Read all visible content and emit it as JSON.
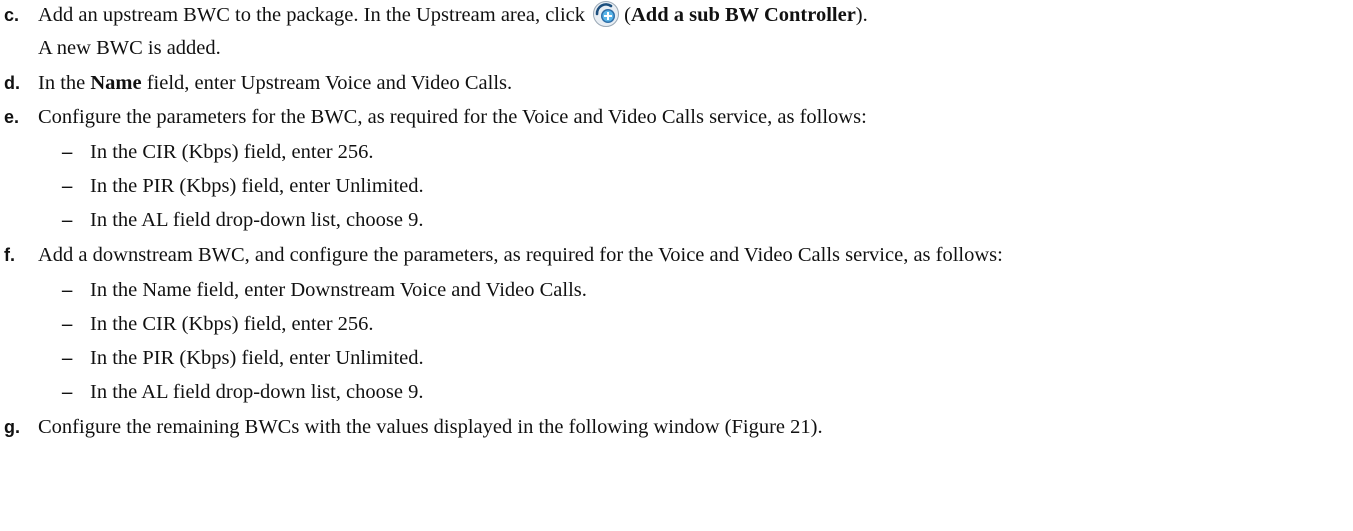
{
  "steps": [
    {
      "marker": "c.",
      "pre": "Add an upstream BWC to the package. In the Upstream area, click",
      "icon": "add-sub-bw-controller-icon",
      "paren_open": "(",
      "bold": "Add a sub BW Controller",
      "post": ").",
      "continuation": "A new BWC is added."
    },
    {
      "marker": "d.",
      "pre": "In the",
      "bold": "Name",
      "post": "field, enter Upstream Voice and Video Calls."
    },
    {
      "marker": "e.",
      "text": "Configure the parameters for the BWC, as required for the Voice and Video Calls service, as follows:",
      "subitems": [
        "In the CIR (Kbps) field, enter 256.",
        "In the PIR (Kbps) field, enter Unlimited.",
        "In the AL field drop-down list, choose 9."
      ]
    },
    {
      "marker": "f.",
      "text": "Add a downstream BWC, and configure the parameters, as required for the Voice and Video Calls service, as follows:",
      "subitems": [
        "In the Name field, enter Downstream Voice and Video Calls.",
        "In the CIR (Kbps) field, enter 256.",
        "In the PIR (Kbps) field, enter Unlimited.",
        "In the AL field drop-down list, choose 9."
      ]
    },
    {
      "marker": "g.",
      "text": "Configure the remaining BWCs with the values displayed in the following window (Figure 21)."
    }
  ],
  "dash": "–",
  "colors": {
    "icon_outer": "#2f6fa8",
    "icon_inner": "#58b4e8",
    "icon_plus": "#ffffff",
    "icon_arc": "#1d4f7d"
  }
}
